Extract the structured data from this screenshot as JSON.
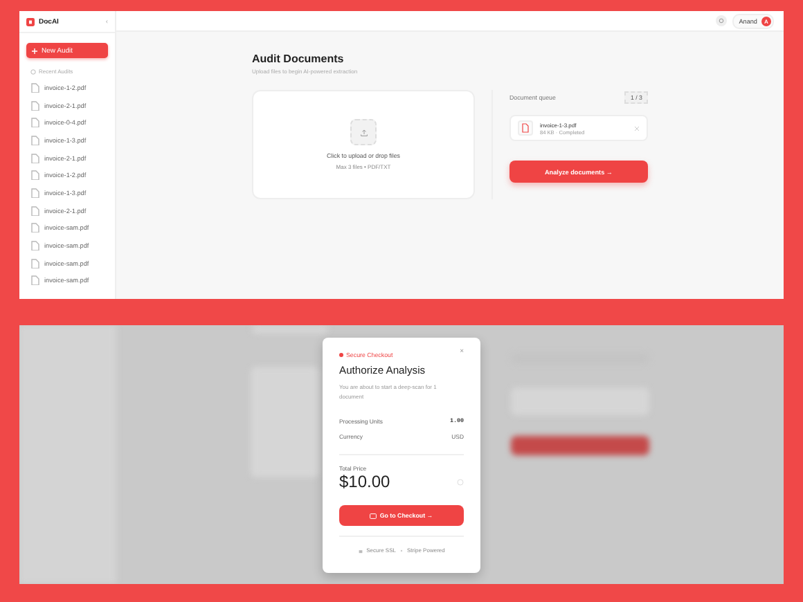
{
  "app": {
    "logo": "DocAI",
    "collapse": "‹",
    "new_button": "New Audit",
    "recent_label": "Recent Audits",
    "recent": [
      "invoice-1-2.pdf",
      "invoice-2-1.pdf",
      "invoice-0-4.pdf",
      "invoice-1-3.pdf",
      "invoice-2-1.pdf",
      "invoice-1-2.pdf",
      "invoice-1-3.pdf",
      "invoice-2-1.pdf",
      "invoice-sam.pdf",
      "invoice-sam.pdf",
      "invoice-sam.pdf",
      "invoice-sam.pdf"
    ],
    "user": {
      "name": "Anand",
      "initial": "A"
    },
    "title": "Audit Documents",
    "subtitle": "Upload files to begin AI-powered extraction",
    "dropzone": {
      "primary": "Click to upload or drop files",
      "secondary": "Max 3 files • PDF/TXT"
    },
    "queue": {
      "label": "Document queue",
      "count": "1",
      "sep": "/",
      "max": "3",
      "files": [
        {
          "name": "invoice-1-3.pdf",
          "meta": "84 KB · Completed"
        }
      ]
    },
    "analyze_button": "Analyze documents →"
  },
  "checkout": {
    "tag": "Secure Checkout",
    "close": "×",
    "title": "Authorize Analysis",
    "description": "You are about to start a deep-scan for 1 document",
    "rows": [
      {
        "label": "Processing Units",
        "value": "1.00",
        "kind": "mono"
      },
      {
        "label": "Currency",
        "value": "USD",
        "kind": "plain"
      }
    ],
    "total_label": "Total Price",
    "total": "$10.00",
    "button": "Go to Checkout →",
    "footer": [
      "Secure SSL",
      "Stripe Powered"
    ]
  }
}
